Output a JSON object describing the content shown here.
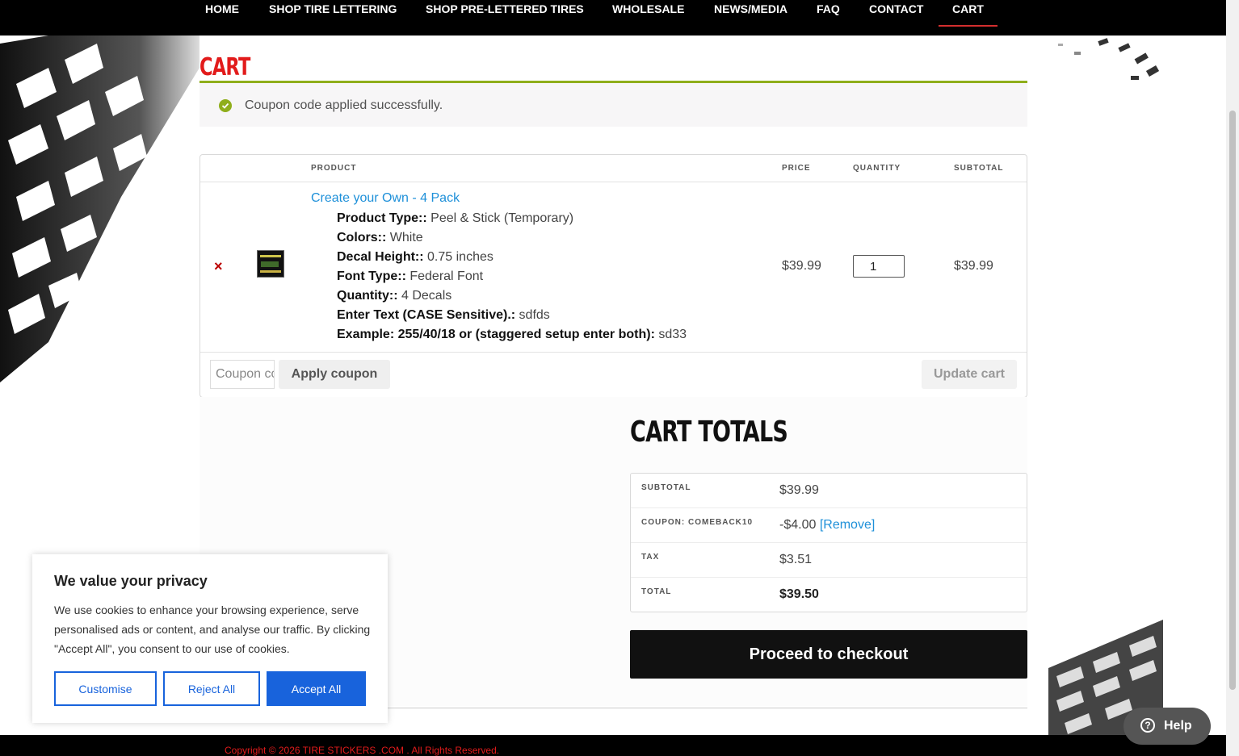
{
  "nav": {
    "items": [
      {
        "label": "HOME"
      },
      {
        "label": "SHOP TIRE LETTERING"
      },
      {
        "label": "SHOP PRE-LETTERED TIRES"
      },
      {
        "label": "WHOLESALE"
      },
      {
        "label": "NEWS/MEDIA"
      },
      {
        "label": "FAQ"
      },
      {
        "label": "CONTACT"
      },
      {
        "label": "CART"
      }
    ],
    "active": "CART",
    "active_color": "#d32f2f"
  },
  "page": {
    "title": "CART",
    "title_color": "#e21b1b",
    "accent_color": "#8fae1b"
  },
  "notice": {
    "icon": "check-circle-icon",
    "text": "Coupon code applied successfully."
  },
  "cart": {
    "headers": {
      "product": "PRODUCT",
      "price": "PRICE",
      "quantity": "QUANTITY",
      "subtotal": "SUBTOTAL"
    },
    "item": {
      "remove_icon": "×",
      "name": "Create your Own - 4 Pack",
      "meta": [
        {
          "label": "Product Type::",
          "value": "Peel & Stick (Temporary)"
        },
        {
          "label": "Colors::",
          "value": "White"
        },
        {
          "label": "Decal Height::",
          "value": "0.75 inches"
        },
        {
          "label": "Font Type::",
          "value": "Federal Font"
        },
        {
          "label": "Quantity::",
          "value": "4 Decals"
        },
        {
          "label": "Enter Text (CASE Sensitive).:",
          "value": "sdfds"
        },
        {
          "label": "Example: 255/40/18 or (staggered setup enter both):",
          "value": "sd33"
        }
      ],
      "price": "$39.99",
      "quantity": "1",
      "subtotal": "$39.99"
    },
    "coupon_placeholder": "Coupon code",
    "apply_label": "Apply coupon",
    "update_label": "Update cart"
  },
  "totals": {
    "title": "CART TOTALS",
    "rows": [
      {
        "label": "SUBTOTAL",
        "value": "$39.99"
      },
      {
        "label": "COUPON: COMEBACK10",
        "value": "-$4.00",
        "link": "[Remove]"
      },
      {
        "label": "TAX",
        "value": "$3.51"
      },
      {
        "label": "TOTAL",
        "value": "$39.50"
      }
    ],
    "checkout_label": "Proceed to checkout"
  },
  "cookie": {
    "title": "We value your privacy",
    "text": "We use cookies to enhance your browsing experience, serve personalised ads or content, and analyse our traffic. By clicking \"Accept All\", you consent to our use of cookies.",
    "customise": "Customise",
    "reject": "Reject All",
    "accept": "Accept All",
    "accent_color": "#1863dc"
  },
  "help": {
    "icon": "question-circle-icon",
    "label": "Help"
  },
  "footer": {
    "copyright": "Copyright © 2026 TIRE STICKERS .COM . All Rights Reserved."
  }
}
